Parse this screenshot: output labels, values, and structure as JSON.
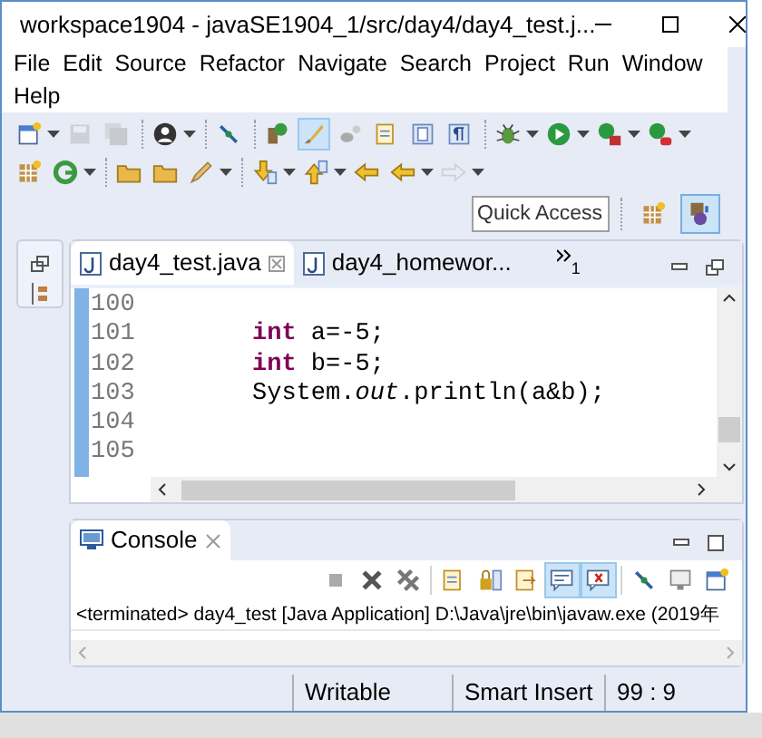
{
  "window": {
    "title": "workspace1904 - javaSE1904_1/src/day4/day4_test.j..."
  },
  "menu": [
    "File",
    "Edit",
    "Source",
    "Refactor",
    "Navigate",
    "Search",
    "Project",
    "Run",
    "Window",
    "Help"
  ],
  "toolbar_rows": [
    [
      {
        "kind": "new",
        "dropdown": true,
        "selected": false,
        "disabled": false
      },
      {
        "kind": "save",
        "dropdown": false,
        "selected": false,
        "disabled": true
      },
      {
        "kind": "saveall",
        "dropdown": false,
        "selected": false,
        "disabled": true
      },
      {
        "kind": "sep"
      },
      {
        "kind": "person",
        "dropdown": true,
        "selected": false,
        "disabled": false
      },
      {
        "kind": "sep"
      },
      {
        "kind": "pin",
        "dropdown": false,
        "selected": false,
        "disabled": false
      },
      {
        "kind": "sep"
      },
      {
        "kind": "tip",
        "dropdown": false,
        "selected": false,
        "disabled": false
      },
      {
        "kind": "brush",
        "dropdown": false,
        "selected": true,
        "disabled": false
      },
      {
        "kind": "gray",
        "dropdown": false,
        "selected": false,
        "disabled": false
      },
      {
        "kind": "doc",
        "dropdown": false,
        "selected": false,
        "disabled": false
      },
      {
        "kind": "page",
        "dropdown": false,
        "selected": false,
        "disabled": false
      },
      {
        "kind": "pilcrow",
        "dropdown": false,
        "selected": false,
        "disabled": false
      },
      {
        "kind": "sep"
      },
      {
        "kind": "bug",
        "dropdown": true,
        "selected": false,
        "disabled": false
      },
      {
        "kind": "run",
        "dropdown": true,
        "selected": false,
        "disabled": false
      },
      {
        "kind": "coverage",
        "dropdown": true,
        "selected": false,
        "disabled": false
      },
      {
        "kind": "external",
        "dropdown": true,
        "selected": false,
        "disabled": false
      }
    ],
    [
      {
        "kind": "grid",
        "dropdown": false,
        "selected": false,
        "disabled": false
      },
      {
        "kind": "refresh",
        "dropdown": true,
        "selected": false,
        "disabled": false
      },
      {
        "kind": "sep"
      },
      {
        "kind": "folder",
        "dropdown": false,
        "selected": false,
        "disabled": false
      },
      {
        "kind": "folder",
        "dropdown": false,
        "selected": false,
        "disabled": false
      },
      {
        "kind": "pencil",
        "dropdown": true,
        "selected": false,
        "disabled": false
      },
      {
        "kind": "sep"
      },
      {
        "kind": "down",
        "dropdown": true,
        "selected": false,
        "disabled": false
      },
      {
        "kind": "up",
        "dropdown": true,
        "selected": false,
        "disabled": false
      },
      {
        "kind": "back",
        "dropdown": false,
        "selected": false,
        "disabled": false
      },
      {
        "kind": "left",
        "dropdown": true,
        "selected": false,
        "disabled": false
      },
      {
        "kind": "right",
        "dropdown": true,
        "selected": false,
        "disabled": true
      }
    ]
  ],
  "quick_access": {
    "placeholder": "Quick Access"
  },
  "perspectives": [
    {
      "kind": "grid",
      "selected": false
    },
    {
      "kind": "java",
      "selected": true
    }
  ],
  "editor": {
    "tabs": [
      {
        "label": "day4_test.java",
        "selected": true
      },
      {
        "label": "day4_homewor...",
        "selected": false
      }
    ],
    "overflow_count": "1",
    "lines": [
      {
        "number": "100"
      },
      {
        "number": "101",
        "code": "int a=-5;"
      },
      {
        "number": "102",
        "code": "int b=-5;"
      },
      {
        "number": "103",
        "code": "System.*out*.println(a&b);"
      },
      {
        "number": "104"
      },
      {
        "number": "105"
      }
    ]
  },
  "console": {
    "title": "Console",
    "tools": [
      {
        "kind": "stop",
        "selected": false
      },
      {
        "kind": "remove",
        "selected": false
      },
      {
        "kind": "removeall",
        "selected": false
      },
      {
        "kind": "sep"
      },
      {
        "kind": "doc",
        "selected": false
      },
      {
        "kind": "lock",
        "selected": false
      },
      {
        "kind": "wrap",
        "selected": false
      },
      {
        "kind": "show",
        "selected": true
      },
      {
        "kind": "showerr",
        "selected": true
      },
      {
        "kind": "sep"
      },
      {
        "kind": "pin",
        "selected": false
      },
      {
        "kind": "display",
        "selected": false
      },
      {
        "kind": "new",
        "selected": false
      }
    ],
    "header": "<terminated> day4_test [Java Application] D:\\Java\\jre\\bin\\javaw.exe (2019年"
  },
  "status_bar": [
    "Writable",
    "Smart Insert",
    "99 : 9"
  ]
}
